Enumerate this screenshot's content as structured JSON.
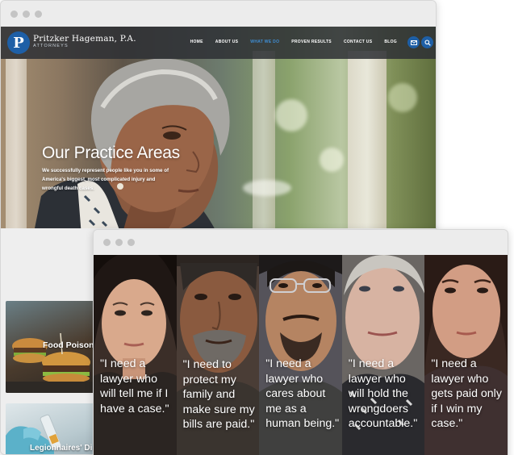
{
  "back_window": {
    "site": {
      "logo_letter": "P",
      "firm_name": "Pritzker Hageman, P.A.",
      "firm_subtitle": "ATTORNEYS"
    },
    "nav": {
      "items": [
        "HOME",
        "ABOUT US",
        "WHAT WE DO",
        "PROVEN RESULTS",
        "CONTACT US",
        "BLOG"
      ],
      "active_index": 2
    },
    "icons": [
      "email-icon",
      "search-icon"
    ],
    "hero": {
      "title": "Our Practice Areas",
      "subtitle": "We successfully represent people like you in some of America's biggest, most complicated injury and wrongful death cases."
    },
    "cards": [
      {
        "label": "Food Poisoni"
      },
      {
        "label": "Legionnaires' Di"
      }
    ]
  },
  "front_window": {
    "quotes": [
      "\"I need a lawyer who will tell me if I have a case.\"",
      "\"I need to protect my family and make sure my bills are paid.\"",
      "\"I need a lawyer who cares about me as a human being.\"",
      "\"I need a lawyer who will hold the wrongdoers accountable.\"",
      "\"I need a lawyer who gets paid only if I win my case.\""
    ]
  },
  "colors": {
    "brand_blue": "#1e5fa6",
    "active_nav": "#3f8fd6",
    "nav_bar": "#2d3034"
  }
}
